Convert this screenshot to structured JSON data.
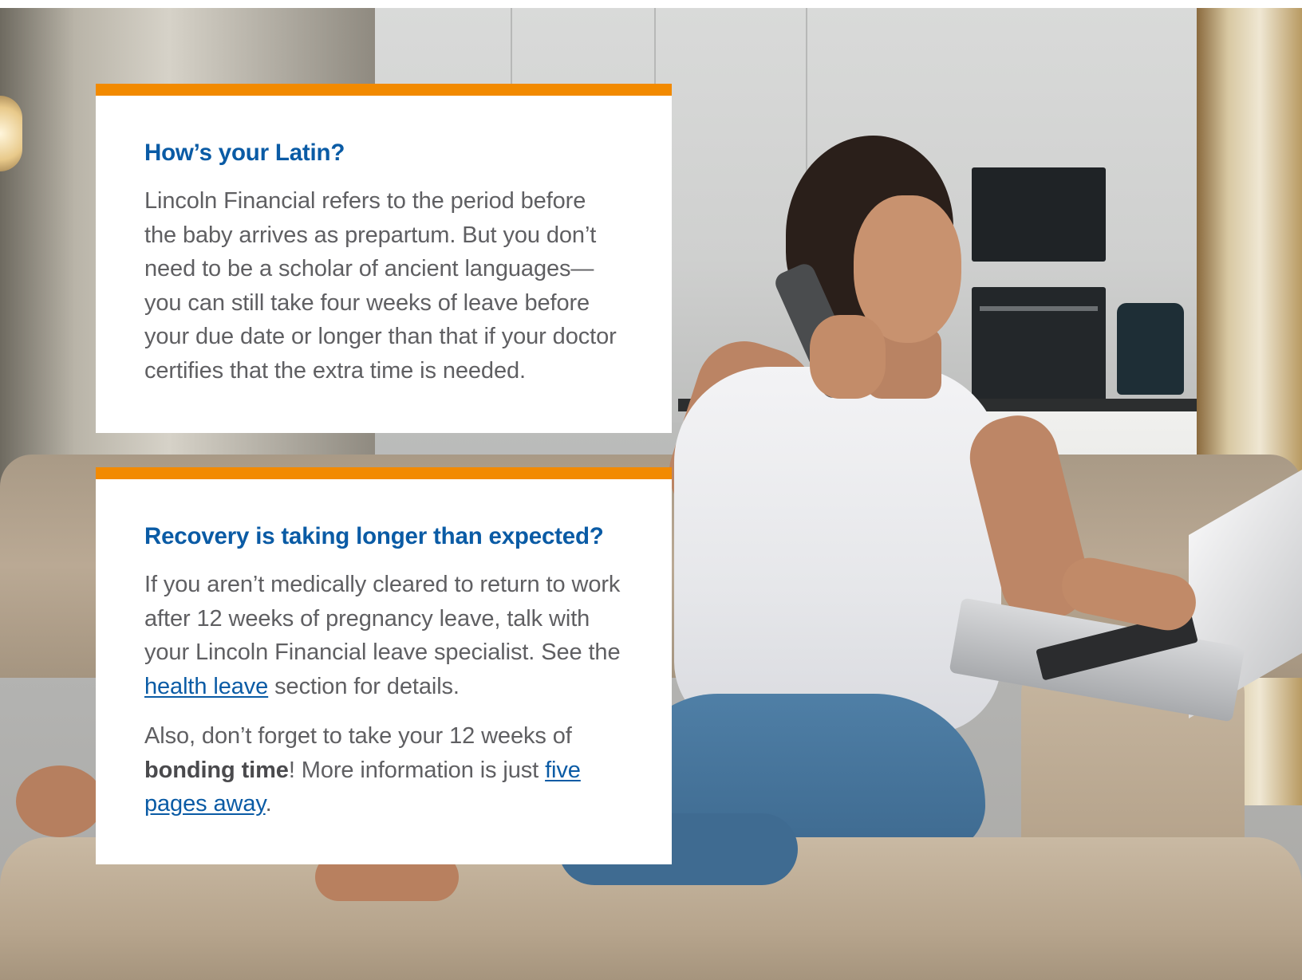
{
  "card_1": {
    "heading": "How’s your Latin?",
    "body": "Lincoln Financial refers to the period before the baby arrives as prepartum. But you don’t need to be a scholar of ancient languages—you can still take four weeks of leave before your due date or longer than that if your doctor certifies that the extra time is needed."
  },
  "card_2": {
    "heading": "Recovery is taking longer than expected?",
    "para1_before": "If you aren’t medically cleared to return to work after 12 weeks of pregnancy leave, talk with your Lincoln Financial leave specialist. See the ",
    "para1_link": "health leave",
    "para1_after": " section for details.",
    "para2_before": "Also, don’t forget to take your 12 weeks of ",
    "para2_bold": "bonding time",
    "para2_middle": "! More information is just ",
    "para2_link": "five pages away",
    "para2_after": "."
  },
  "colors": {
    "accent_bar": "#f28a00",
    "heading": "#0a5ba5",
    "body_text": "#5f5f62",
    "link": "#0a5ba5"
  }
}
